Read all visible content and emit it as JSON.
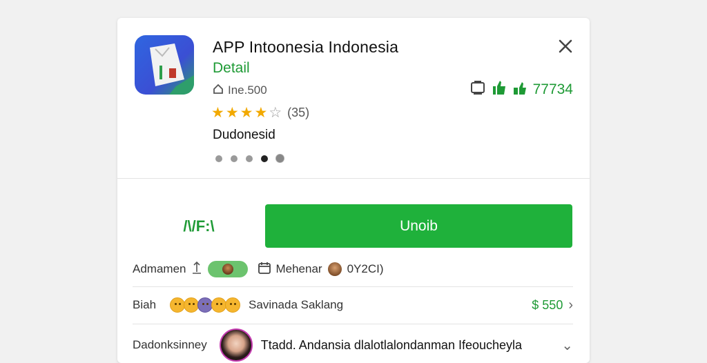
{
  "app": {
    "title": "APP Intoonesia Indonesia",
    "detail_link": "Detail",
    "size": "Ine.500",
    "rating_count": "(35)",
    "developer": "Dudonesid",
    "stats_value": "77734",
    "rating_stars": 4,
    "rating_max": 5
  },
  "actions": {
    "secondary_label": "/\\/F:\\",
    "primary_label": "Unoib"
  },
  "rows": {
    "row1_label": "Admamen",
    "row1_mid": "Mehenar",
    "row1_code": "0Y2CI)",
    "row2_label": "Biah",
    "row2_text": "Savinada Saklang",
    "row2_price": "$ 550",
    "row3_label": "Dadonksinney",
    "row3_text": "Ttadd. Andansia dlalotlalondanman Ifeoucheyla"
  },
  "colors": {
    "accent": "#1fb13b",
    "link": "#1e9a35",
    "star": "#f2a900"
  },
  "icons": [
    "close-icon",
    "tag-icon",
    "star-icon",
    "phone-icon",
    "thumbs-up-icon",
    "share-icon",
    "calendar-icon",
    "chevron-right-icon",
    "chevron-down-icon"
  ]
}
